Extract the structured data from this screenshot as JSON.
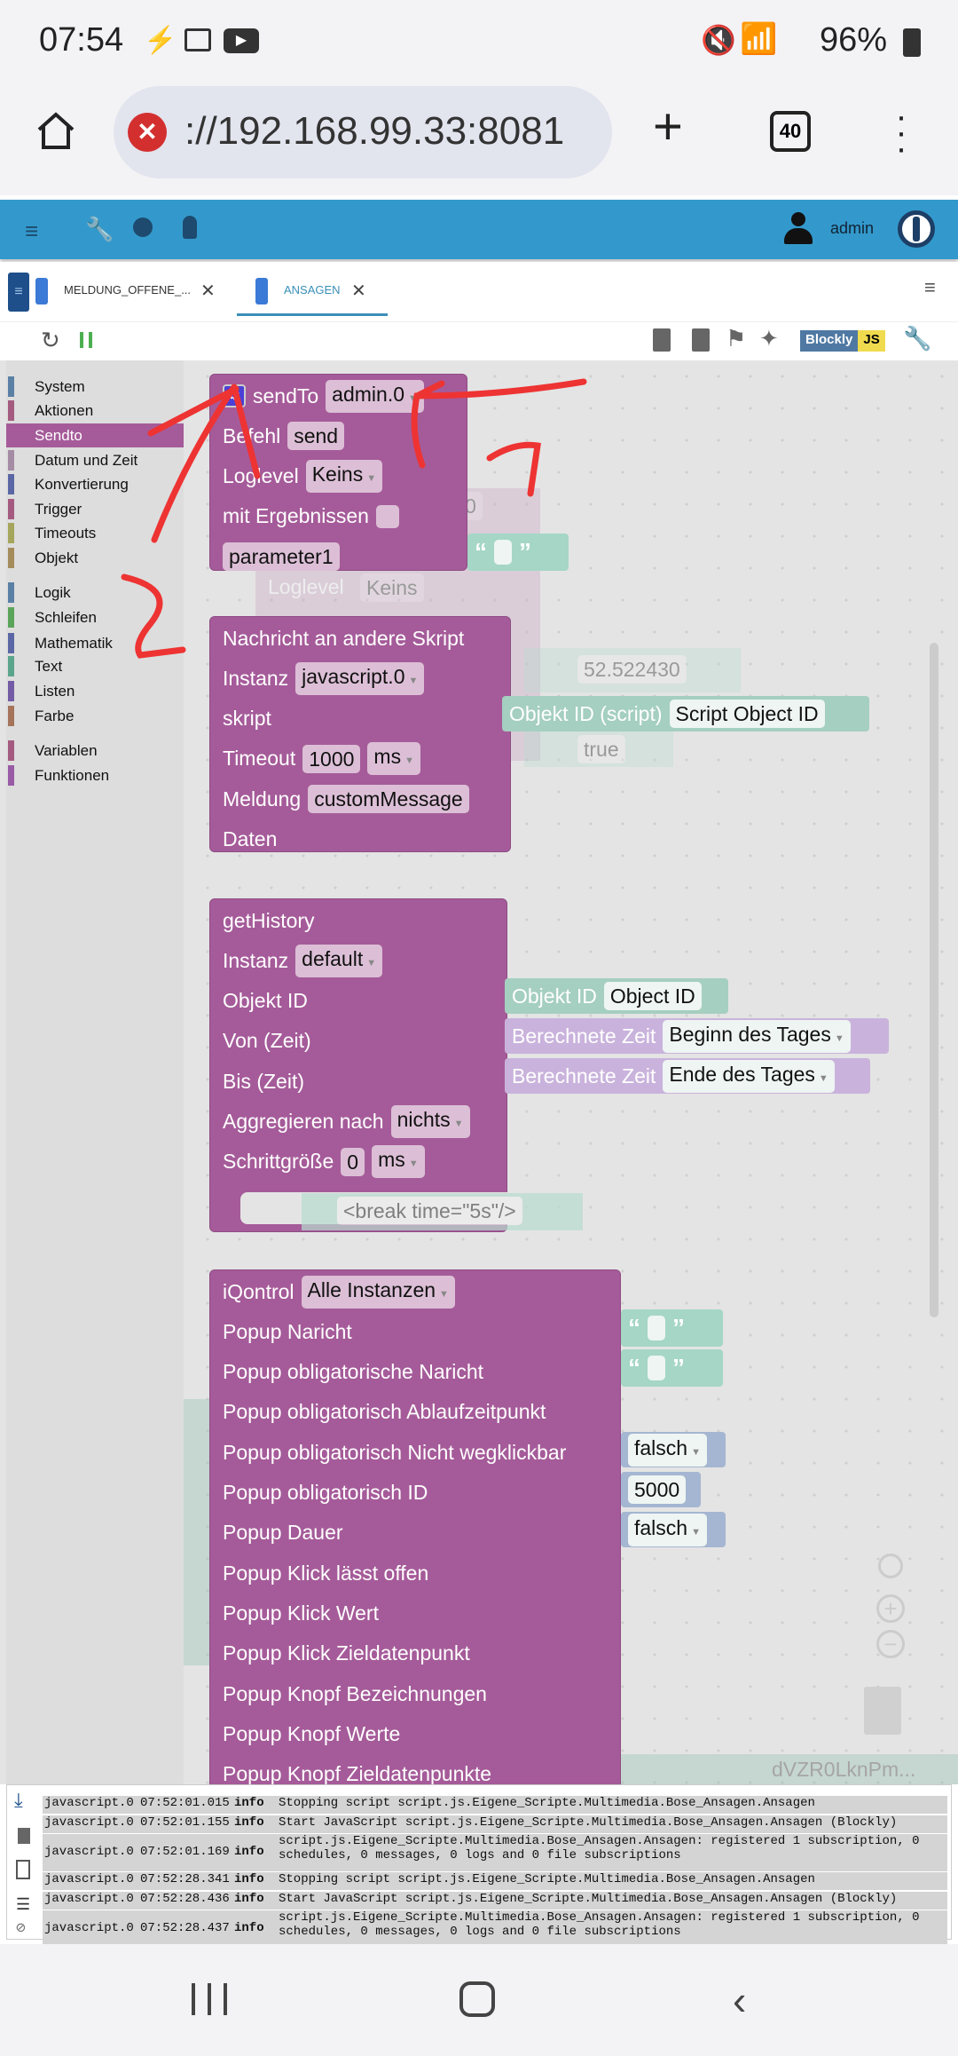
{
  "status_bar": {
    "time": "07:54",
    "battery": "96%"
  },
  "browser": {
    "url": "://192.168.99.33:8081",
    "tab_count": "40"
  },
  "app_bar": {
    "user": "admin"
  },
  "tabs": [
    {
      "label": "MELDUNG_OFFENE_...",
      "active": false
    },
    {
      "label": "ANSAGEN",
      "active": true
    }
  ],
  "toolbar": {
    "mode_badge_left": "Blockly",
    "mode_badge_right": "JS"
  },
  "categories": [
    {
      "label": "System",
      "color": "#5b80a5"
    },
    {
      "label": "Aktionen",
      "color": "#a55b80"
    },
    {
      "label": "Sendto",
      "color": "#a55b99",
      "selected": true
    },
    {
      "label": "Datum und Zeit",
      "color": "#a58ca5"
    },
    {
      "label": "Konvertierung",
      "color": "#5b67a5"
    },
    {
      "label": "Trigger",
      "color": "#a55b80"
    },
    {
      "label": "Timeouts",
      "color": "#a5a55b"
    },
    {
      "label": "Objekt",
      "color": "#a58c5b"
    },
    {
      "label": "Logik",
      "color": "#5b80a5"
    },
    {
      "label": "Schleifen",
      "color": "#5ba55b"
    },
    {
      "label": "Mathematik",
      "color": "#5b67a5"
    },
    {
      "label": "Text",
      "color": "#5ba58c"
    },
    {
      "label": "Listen",
      "color": "#745ba5"
    },
    {
      "label": "Farbe",
      "color": "#a5745b"
    },
    {
      "label": "Variablen",
      "color": "#a55b80"
    },
    {
      "label": "Funktionen",
      "color": "#995ba5"
    }
  ],
  "blocks": [
    {
      "name": "sendto-block",
      "rows": [
        {
          "label": "sendTo",
          "gear": true,
          "fields": [
            {
              "text": "admin.0",
              "dropdown": true
            }
          ]
        },
        {
          "label": "Befehl",
          "fields": [
            {
              "text": "send"
            }
          ]
        },
        {
          "label": "Loglevel",
          "fields": [
            {
              "text": "Keins",
              "dropdown": true
            }
          ]
        },
        {
          "label": "mit Ergebnissen",
          "checkbox": true
        },
        {
          "label": "",
          "fields": [
            {
              "text": "parameter1"
            }
          ]
        }
      ]
    },
    {
      "name": "message-to-script-block",
      "rows": [
        {
          "label": "Nachricht an andere Skript"
        },
        {
          "label": "Instanz",
          "fields": [
            {
              "text": "javascript.0",
              "dropdown": true
            }
          ]
        },
        {
          "label": "skript"
        },
        {
          "label": "Timeout",
          "fields": [
            {
              "text": "1000"
            },
            {
              "text": "ms",
              "dropdown": true
            }
          ]
        },
        {
          "label": "Meldung",
          "fields": [
            {
              "text": "customMessage"
            }
          ]
        },
        {
          "label": "Daten"
        }
      ]
    },
    {
      "name": "gethistory-block",
      "rows": [
        {
          "label": "getHistory"
        },
        {
          "label": "Instanz",
          "fields": [
            {
              "text": "default",
              "dropdown": true
            }
          ]
        },
        {
          "label": "Objekt ID"
        },
        {
          "label": "Von (Zeit)"
        },
        {
          "label": "Bis (Zeit)"
        },
        {
          "label": "Aggregieren nach",
          "fields": [
            {
              "text": "nichts",
              "dropdown": true
            }
          ]
        },
        {
          "label": "Schrittgröße",
          "fields": [
            {
              "text": "0"
            },
            {
              "text": "ms",
              "dropdown": true
            }
          ]
        }
      ]
    },
    {
      "name": "iqontrol-block",
      "rows": [
        {
          "label": "iQontrol",
          "fields": [
            {
              "text": "Alle Instanzen",
              "dropdown": true
            }
          ]
        },
        {
          "label": "Popup Naricht"
        },
        {
          "label": "Popup obligatorische Naricht"
        },
        {
          "label": "Popup obligatorisch Ablaufzeitpunkt"
        },
        {
          "label": "Popup obligatorisch Nicht wegklickbar"
        },
        {
          "label": "Popup obligatorisch ID"
        },
        {
          "label": "Popup Dauer"
        },
        {
          "label": "Popup Klick lässt offen"
        },
        {
          "label": "Popup Klick Wert"
        },
        {
          "label": "Popup Klick Zieldatenpunkt"
        },
        {
          "label": "Popup Knopf Bezeichnungen"
        },
        {
          "label": "Popup Knopf Werte"
        },
        {
          "label": "Popup Knopf Zieldatenpunkte"
        }
      ]
    }
  ],
  "value_blocks": [
    {
      "kind": "text",
      "label": "",
      "field": ""
    },
    {
      "kind": "object-id",
      "label": "Objekt ID (script)",
      "field": "Script Object ID"
    },
    {
      "kind": "object-id",
      "label": "Objekt ID",
      "field": "Object ID"
    },
    {
      "kind": "time",
      "label": "Berechnete Zeit",
      "field": "Beginn des Tages",
      "dropdown": true
    },
    {
      "kind": "time",
      "label": "Berechnete Zeit",
      "field": "Ende des Tages",
      "dropdown": true
    },
    {
      "kind": "text",
      "label": "",
      "field": ""
    },
    {
      "kind": "text",
      "label": "",
      "field": ""
    },
    {
      "kind": "bool",
      "label": "",
      "field": "falsch",
      "dropdown": true
    },
    {
      "kind": "number",
      "label": "",
      "field": "5000"
    },
    {
      "kind": "bool",
      "label": "",
      "field": "falsch",
      "dropdown": true
    }
  ],
  "ghost_texts": [
    "Loglevel",
    "Keins",
    "n.0",
    "52.522430",
    "true",
    "<break time=\"5s\"/>",
    "dVZR0LknPm..."
  ],
  "block_colors": {
    "sendto": "#a55b99",
    "text": "#a5d6c6",
    "object": "#a5cfc0",
    "time": "#c9b3dc",
    "logic": "#a5b6d2"
  },
  "log": [
    {
      "source": "javascript.0",
      "time": "07:52:01.015",
      "level": "info",
      "message": "Stopping script script.js.Eigene_Scripte.Multimedia.Bose_Ansagen.Ansagen"
    },
    {
      "source": "javascript.0",
      "time": "07:52:01.155",
      "level": "info",
      "message": "Start JavaScript script.js.Eigene_Scripte.Multimedia.Bose_Ansagen.Ansagen (Blockly)"
    },
    {
      "source": "javascript.0",
      "time": "07:52:01.169",
      "level": "info",
      "message": "script.js.Eigene_Scripte.Multimedia.Bose_Ansagen.Ansagen: registered 1 subscription, 0 schedules, 0 messages, 0 logs and 0 file subscriptions"
    },
    {
      "source": "javascript.0",
      "time": "07:52:28.341",
      "level": "info",
      "message": "Stopping script script.js.Eigene_Scripte.Multimedia.Bose_Ansagen.Ansagen"
    },
    {
      "source": "javascript.0",
      "time": "07:52:28.436",
      "level": "info",
      "message": "Start JavaScript script.js.Eigene_Scripte.Multimedia.Bose_Ansagen.Ansagen (Blockly)"
    },
    {
      "source": "javascript.0",
      "time": "07:52:28.437",
      "level": "info",
      "message": "script.js.Eigene_Scripte.Multimedia.Bose_Ansagen.Ansagen: registered 1 subscription, 0 schedules, 0 messages, 0 logs and 0 file subscriptions"
    }
  ]
}
